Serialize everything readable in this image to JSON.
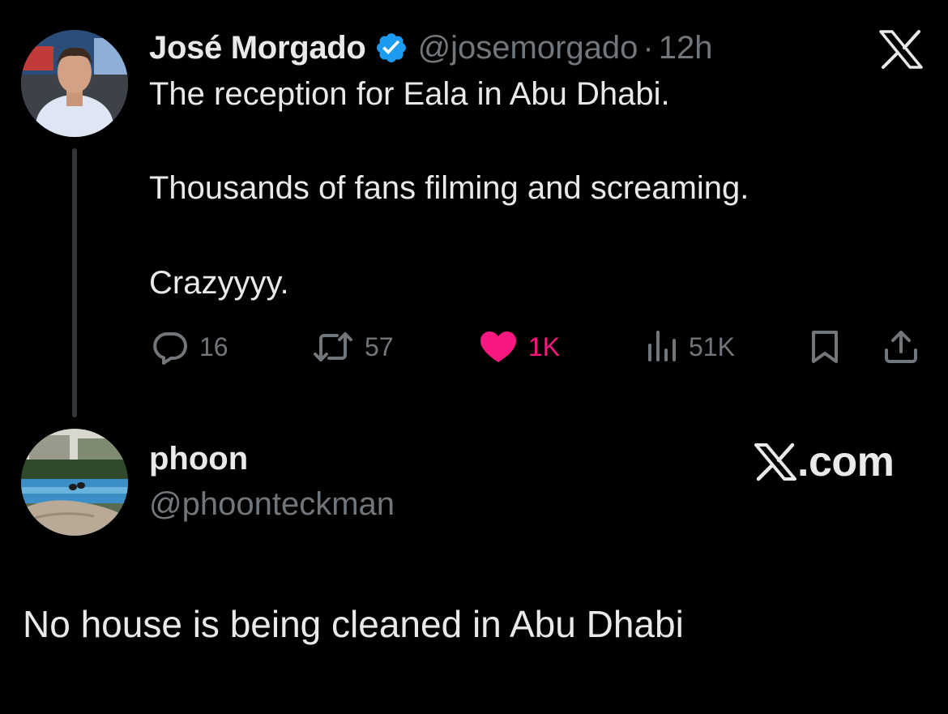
{
  "colors": {
    "background": "#000000",
    "text": "#e7e9ea",
    "muted": "#71767b",
    "verified": "#1d9bf0",
    "like": "#f91880",
    "thread_line": "#333639"
  },
  "tweet": {
    "author": {
      "name": "José Morgado",
      "handle": "@josemorgado",
      "verified_icon": "verified-badge-icon",
      "avatar": "avatar-photo"
    },
    "separator": "·",
    "time": "12h",
    "platform_icon": "x-logo-icon",
    "lines": [
      "The reception for Eala in Abu Dhabi.",
      "Thousands of fans filming and screaming.",
      "Crazyyyy."
    ],
    "actions": {
      "reply": {
        "icon": "reply-icon",
        "count": "16"
      },
      "retweet": {
        "icon": "retweet-icon",
        "count": "57"
      },
      "like": {
        "icon": "heart-icon",
        "count": "1K",
        "liked": true
      },
      "views": {
        "icon": "views-icon",
        "count": "51K"
      },
      "bookmark": {
        "icon": "bookmark-icon"
      },
      "share": {
        "icon": "share-icon"
      }
    }
  },
  "reply": {
    "author": {
      "name": "phoon",
      "handle": "@phoonteckman",
      "avatar": "avatar-photo"
    },
    "brand": ".com",
    "brand_icon": "x-logo-icon",
    "text": "No house is being cleaned in Abu Dhabi"
  }
}
